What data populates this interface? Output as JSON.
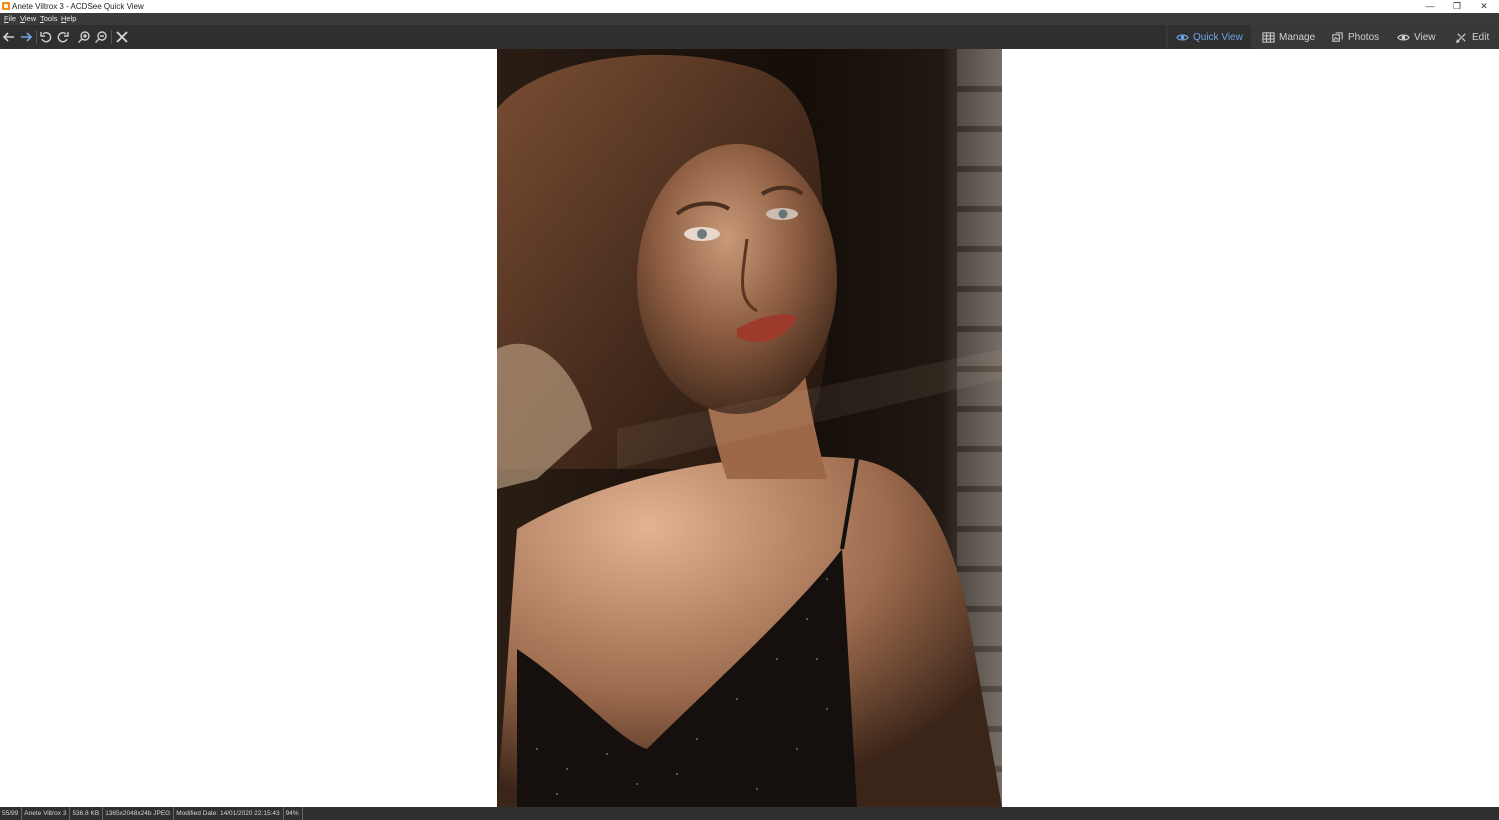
{
  "window": {
    "title": "Anete Viltrox 3 - ACDSee Quick View",
    "min_glyph": "—",
    "max_glyph": "❐",
    "close_glyph": "✕"
  },
  "menu": [
    {
      "accel": "F",
      "rest": "ile"
    },
    {
      "accel": "V",
      "rest": "iew"
    },
    {
      "accel": "T",
      "rest": "ools"
    },
    {
      "accel": "H",
      "rest": "elp"
    }
  ],
  "toolbar": {
    "icons": [
      "arrow-left-icon",
      "arrow-right-icon",
      "rotate-left-icon",
      "rotate-right-icon",
      "zoom-in-icon",
      "zoom-out-icon",
      "close-icon"
    ]
  },
  "modes": [
    {
      "label": "Quick View",
      "icon": "eye-icon",
      "active": true
    },
    {
      "label": "Manage",
      "icon": "grid-icon",
      "active": false
    },
    {
      "label": "Photos",
      "icon": "photos-icon",
      "active": false
    },
    {
      "label": "View",
      "icon": "eye-icon",
      "active": false
    },
    {
      "label": "Edit",
      "icon": "edit-icon",
      "active": false
    }
  ],
  "status": {
    "position": "55/99",
    "filename": "Anete Viltrox 3",
    "size": "536.8 KB",
    "dimensions": "1365x2048x24b JPEG",
    "modified": "Modified Date: 14/01/2020 22:15:43",
    "zoom": "94%"
  },
  "colors": {
    "accent": "#6fa5e6",
    "toolbar_bg": "#2f2f2f",
    "app_icon": "#f28c1a"
  }
}
